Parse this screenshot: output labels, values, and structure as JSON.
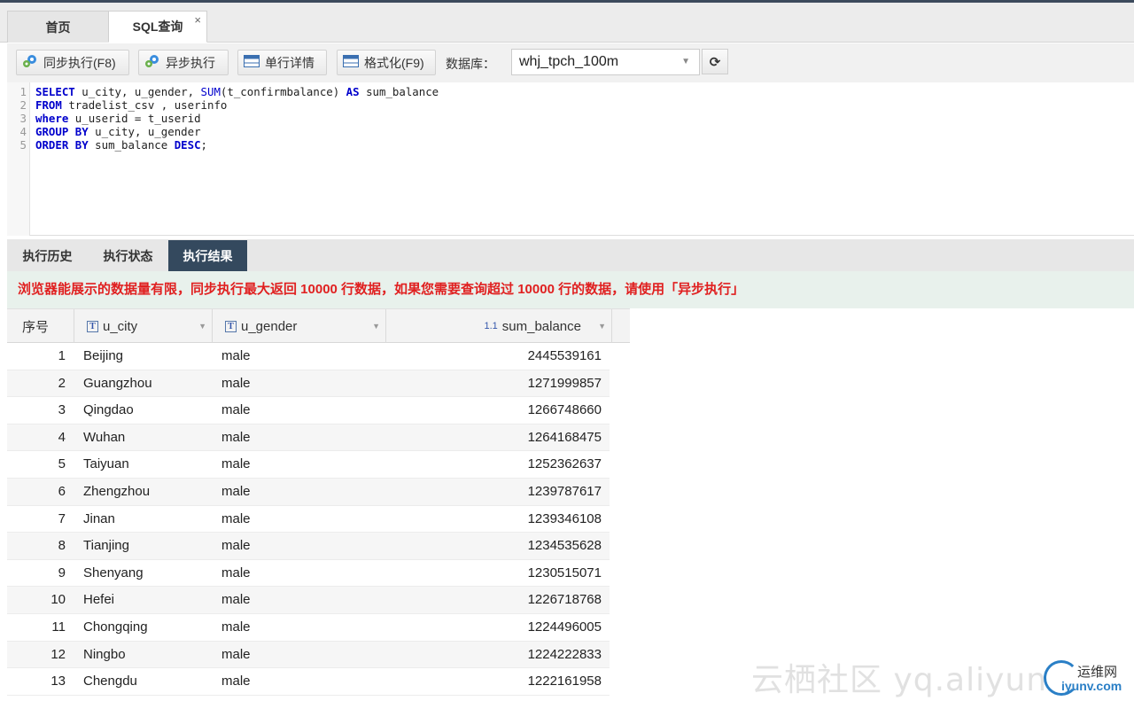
{
  "tabs": {
    "home": "首页",
    "sql": "SQL查询",
    "close": "×"
  },
  "toolbar": {
    "sync_run": "同步执行(F8)",
    "async_run": "异步执行",
    "row_detail": "单行详情",
    "format": "格式化(F9)",
    "db_label": "数据库：",
    "db_value": "whj_tpch_100m"
  },
  "editor": {
    "lines": [
      "SELECT u_city, u_gender, SUM(t_confirmbalance) AS sum_balance",
      "FROM tradelist_csv , userinfo",
      "where u_userid = t_userid",
      "GROUP BY u_city, u_gender",
      "ORDER BY sum_balance DESC;"
    ]
  },
  "result_tabs": {
    "history": "执行历史",
    "status": "执行状态",
    "result": "执行结果"
  },
  "warning": "浏览器能展示的数据量有限，同步执行最大返回 10000 行数据，如果您需要查询超过 10000 行的数据，请使用「异步执行」",
  "grid": {
    "headers": {
      "index": "序号",
      "city": "u_city",
      "gender": "u_gender",
      "balance": "sum_balance"
    },
    "rows": [
      {
        "idx": "1",
        "city": "Beijing",
        "gender": "male",
        "balance": "2445539161"
      },
      {
        "idx": "2",
        "city": "Guangzhou",
        "gender": "male",
        "balance": "1271999857"
      },
      {
        "idx": "3",
        "city": "Qingdao",
        "gender": "male",
        "balance": "1266748660"
      },
      {
        "idx": "4",
        "city": "Wuhan",
        "gender": "male",
        "balance": "1264168475"
      },
      {
        "idx": "5",
        "city": "Taiyuan",
        "gender": "male",
        "balance": "1252362637"
      },
      {
        "idx": "6",
        "city": "Zhengzhou",
        "gender": "male",
        "balance": "1239787617"
      },
      {
        "idx": "7",
        "city": "Jinan",
        "gender": "male",
        "balance": "1239346108"
      },
      {
        "idx": "8",
        "city": "Tianjing",
        "gender": "male",
        "balance": "1234535628"
      },
      {
        "idx": "9",
        "city": "Shenyang",
        "gender": "male",
        "balance": "1230515071"
      },
      {
        "idx": "10",
        "city": "Hefei",
        "gender": "male",
        "balance": "1226718768"
      },
      {
        "idx": "11",
        "city": "Chongqing",
        "gender": "male",
        "balance": "1224496005"
      },
      {
        "idx": "12",
        "city": "Ningbo",
        "gender": "male",
        "balance": "1224222833"
      },
      {
        "idx": "13",
        "city": "Chengdu",
        "gender": "male",
        "balance": "1222161958"
      }
    ]
  },
  "watermark": "云栖社区 yq.aliyun",
  "logo": {
    "cn": "运维网",
    "en": "iyunv.com"
  }
}
